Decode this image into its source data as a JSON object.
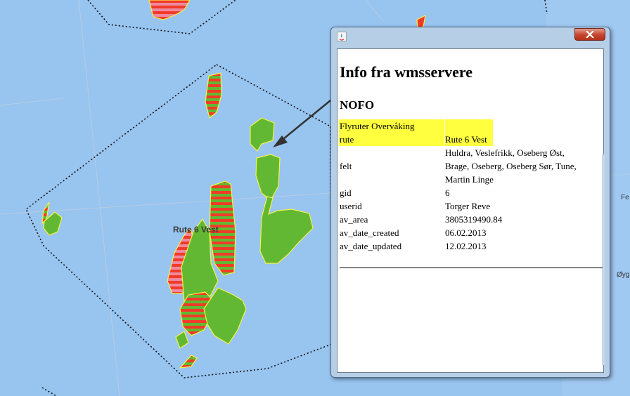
{
  "map": {
    "route_label": "Rute 6 Vest",
    "edge_labels": [
      "Fe",
      "Øyg"
    ]
  },
  "info_window": {
    "heading": "Info fra wmsservere",
    "source": "NOFO",
    "layer_name": "Flyruter Overvåking",
    "attributes": [
      {
        "key": "rute",
        "value": "Rute 6 Vest",
        "highlight": true
      },
      {
        "key": "felt",
        "value_lines": [
          "Huldra, Veslefrikk, Oseberg Øst,",
          "Brage, Oseberg, Oseberg Sør, Tune,",
          "Martin Linge"
        ]
      },
      {
        "key": "gid",
        "value": "6"
      },
      {
        "key": "userid",
        "value": "Torger Reve"
      },
      {
        "key": "av_area",
        "value": "3805319490.84"
      },
      {
        "key": "av_date_created",
        "value": "06.02.2013"
      },
      {
        "key": "av_date_updated",
        "value": "12.02.2013"
      }
    ]
  },
  "colors": {
    "sea": "#98c4f0",
    "field_green": "#62b832",
    "field_red": "#f23a2a",
    "field_pink": "#ee8aa0",
    "highlight": "#ffff40",
    "close_button": "#c4442c"
  },
  "icons": {
    "window_icon": "java-icon",
    "close": "close-icon",
    "pointer": "arrow-icon"
  }
}
